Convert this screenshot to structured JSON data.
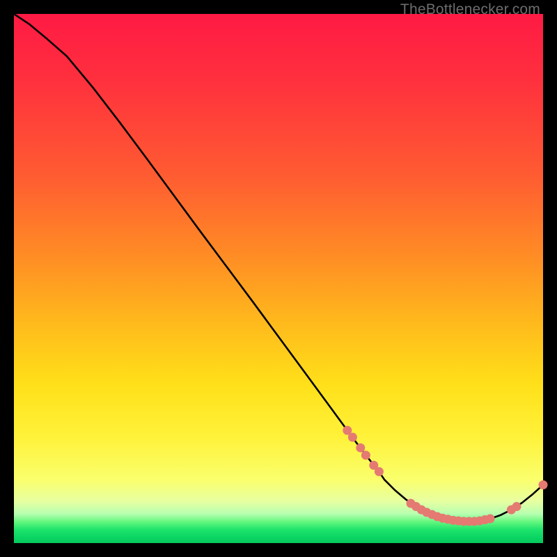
{
  "watermark": "TheBottlenecker.com",
  "chart_data": {
    "type": "line",
    "title": "",
    "xlabel": "",
    "ylabel": "",
    "xlim": [
      0,
      100
    ],
    "ylim": [
      0,
      100
    ],
    "grid": false,
    "colors": {
      "line": "#000000",
      "markers": "#e47a72"
    },
    "series": [
      {
        "name": "curve",
        "x": [
          0,
          3,
          6,
          10,
          15,
          20,
          25,
          30,
          35,
          40,
          45,
          50,
          55,
          60,
          63,
          65,
          67,
          69,
          70,
          72,
          74,
          76,
          78,
          80,
          82,
          84,
          86,
          88,
          90,
          92,
          94,
          96,
          98,
          100
        ],
        "y": [
          100,
          98,
          95.5,
          92,
          86,
          79.5,
          72.8,
          66,
          59.2,
          52.5,
          45.8,
          39,
          32.2,
          25.4,
          21.3,
          18.6,
          16,
          13.5,
          12,
          10,
          8.3,
          6.9,
          5.8,
          5,
          4.5,
          4.2,
          4.1,
          4.2,
          4.6,
          5.3,
          6.3,
          7.6,
          9.2,
          11
        ]
      }
    ],
    "markers": [
      {
        "x": 63,
        "y": 21.3
      },
      {
        "x": 64,
        "y": 20.0
      },
      {
        "x": 65.5,
        "y": 18.0
      },
      {
        "x": 66.5,
        "y": 16.6
      },
      {
        "x": 68,
        "y": 14.7
      },
      {
        "x": 69,
        "y": 13.5
      },
      {
        "x": 75,
        "y": 7.5
      },
      {
        "x": 76,
        "y": 6.9
      },
      {
        "x": 77,
        "y": 6.3
      },
      {
        "x": 78,
        "y": 5.8
      },
      {
        "x": 79,
        "y": 5.4
      },
      {
        "x": 80,
        "y": 5.0
      },
      {
        "x": 81,
        "y": 4.7
      },
      {
        "x": 82,
        "y": 4.5
      },
      {
        "x": 83,
        "y": 4.3
      },
      {
        "x": 84,
        "y": 4.2
      },
      {
        "x": 85,
        "y": 4.1
      },
      {
        "x": 86,
        "y": 4.1
      },
      {
        "x": 87,
        "y": 4.1
      },
      {
        "x": 88,
        "y": 4.2
      },
      {
        "x": 89,
        "y": 4.4
      },
      {
        "x": 90,
        "y": 4.6
      },
      {
        "x": 94,
        "y": 6.3
      },
      {
        "x": 95,
        "y": 6.9
      },
      {
        "x": 100,
        "y": 11.0
      }
    ]
  }
}
